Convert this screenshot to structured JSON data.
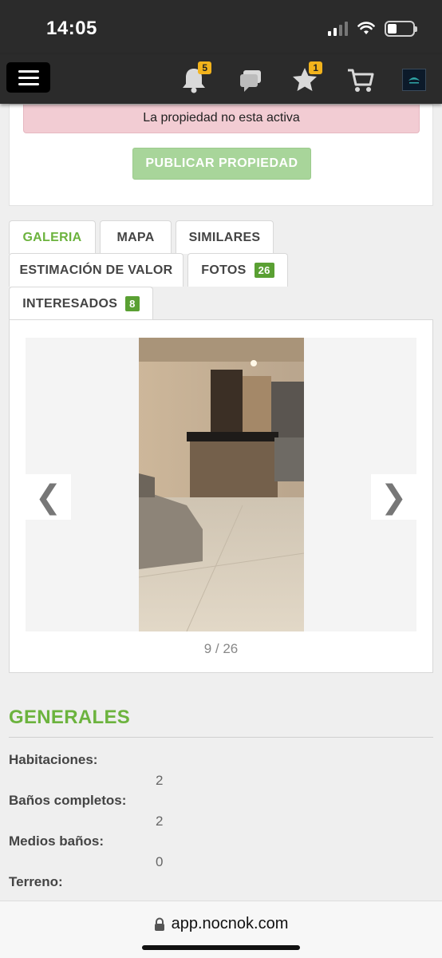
{
  "status_bar": {
    "time": "14:05",
    "battery_level": 0.35
  },
  "nav": {
    "notifications_count": "5",
    "favorites_count": "1",
    "icons": [
      "menu-icon",
      "bell-icon",
      "chat-icon",
      "star-icon",
      "cart-icon",
      "brand-logo"
    ]
  },
  "alert": {
    "message": "La propiedad no esta activa"
  },
  "publish_button": {
    "label": "PUBLICAR PROPIEDAD"
  },
  "tabs": [
    {
      "label": "GALERIA",
      "active": true
    },
    {
      "label": "MAPA"
    },
    {
      "label": "SIMILARES"
    },
    {
      "label": "ESTIMACIÓN DE VALOR"
    },
    {
      "label": "FOTOS",
      "count": "26"
    },
    {
      "label": "INTERESADOS",
      "count": "8"
    }
  ],
  "gallery": {
    "counter": "9 / 26",
    "prev_icon": "❮",
    "next_icon": "❯"
  },
  "generales": {
    "title": "GENERALES",
    "rows": [
      {
        "label": "Habitaciones:",
        "value": "2"
      },
      {
        "label": "Baños completos:",
        "value": "2"
      },
      {
        "label": "Medios baños:",
        "value": "0"
      },
      {
        "label": "Terreno:",
        "value": ""
      }
    ]
  },
  "browser": {
    "url": "app.nocnok.com"
  },
  "colors": {
    "accent_green": "#6cb33e",
    "badge_yellow": "#f2b31c",
    "alert_pink": "#f2ccd3"
  }
}
